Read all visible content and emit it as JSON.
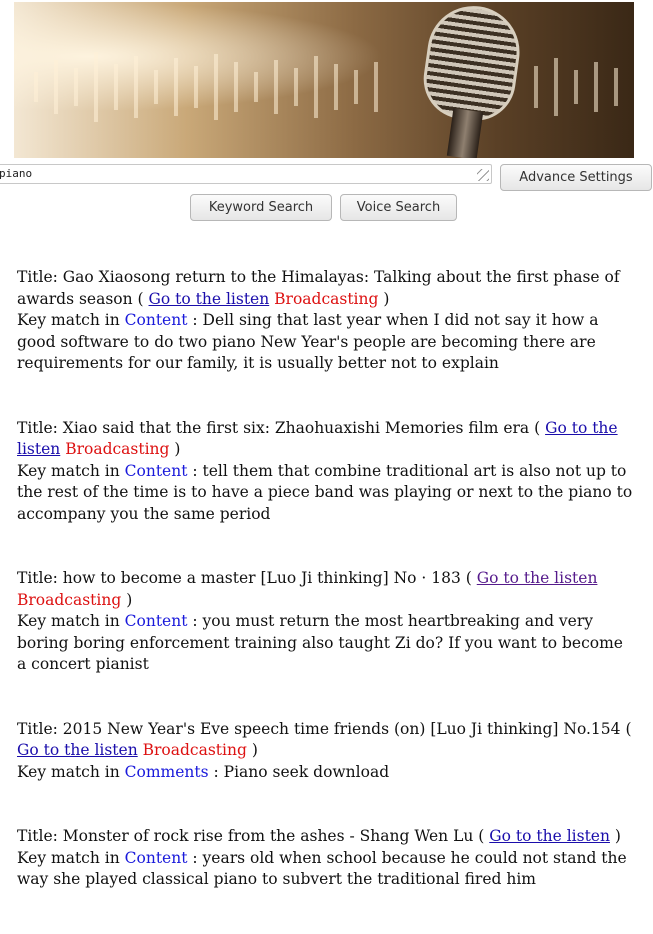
{
  "search": {
    "value": "piano",
    "advance_label": "Advance Settings"
  },
  "buttons": {
    "keyword": "Keyword Search",
    "voice": "Voice Search"
  },
  "colors": {
    "link": "#1a0dab",
    "visited_link": "#551a8b",
    "broadcasting": "#dd1111",
    "match_field": "#1a1adb"
  },
  "results": [
    {
      "title_prefix": "Title: Gao Xiaosong return to the Himalayas: Talking about the first phase of awards season",
      "open_paren": " ( ",
      "link_text": "Go to the listen",
      "broadcasting": " Broadcasting",
      "close_paren": " )",
      "key_prefix": "Key match in ",
      "field": "Content",
      "snippet": " : Dell sing that last year when I did not say it how a good software to do two piano New Year's people are becoming there are requirements for our family, it is usually better not to explain"
    },
    {
      "title_prefix": "Title: Xiao said that the first six: Zhaohuaxishi Memories film era",
      "open_paren": " ( ",
      "link_text": "Go to the listen",
      "broadcasting": " Broadcasting",
      "close_paren": " )",
      "key_prefix": "Key match in ",
      "field": "Content",
      "snippet": " : tell them that combine traditional art is also not up to the rest of the time is to have a piece band was playing or next to the piano to accompany you the same period"
    },
    {
      "title_prefix": "Title: how to become a master [Luo Ji thinking] No · 183",
      "open_paren": " ( ",
      "link_text": "Go to the listen",
      "broadcasting": " Broadcasting",
      "close_paren": " )",
      "key_prefix": "Key match in ",
      "field": "Content",
      "snippet": " : you must return the most heartbreaking and very boring boring enforcement training also taught Zi do? If you want to become a concert pianist"
    },
    {
      "title_prefix": "Title: 2015 New Year's Eve speech time friends (on) [Luo Ji thinking] No.154",
      "open_paren": " ( ",
      "link_text": "Go to the listen",
      "broadcasting": " Broadcasting",
      "close_paren": " )",
      "key_prefix": "Key match in ",
      "field": "Comments",
      "snippet": " : Piano seek download"
    },
    {
      "title_prefix": "Title: Monster of rock rise from the ashes - Shang Wen Lu",
      "open_paren": " ( ",
      "link_text": "Go to the listen",
      "broadcasting": "",
      "close_paren": " )",
      "key_prefix": "Key match in ",
      "field": "Content",
      "snippet": " : years old when school because he could not stand the way she played classical piano to subvert the traditional fired him"
    }
  ]
}
